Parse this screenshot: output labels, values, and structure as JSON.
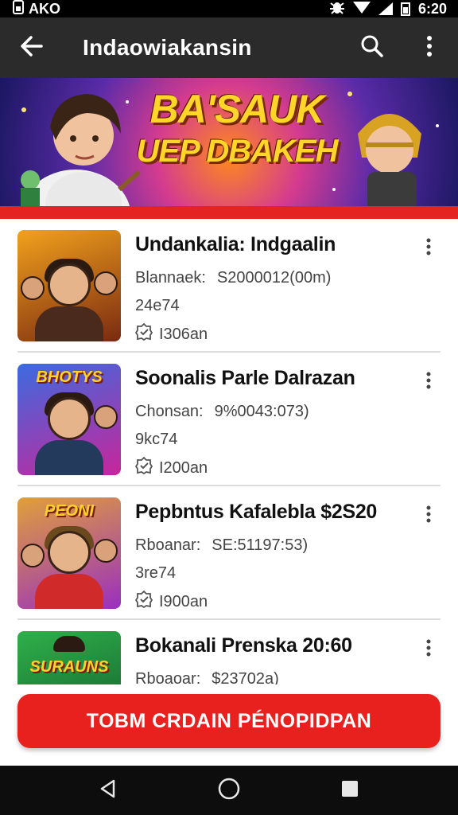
{
  "status_bar": {
    "left_text": "AKO",
    "time": "6:20",
    "icons": [
      "sim-icon",
      "bug-icon",
      "wifi-icon",
      "signal-icon",
      "battery-icon"
    ]
  },
  "app_bar": {
    "title": "Indaowiakansin",
    "icons": [
      "back-arrow-icon",
      "search-icon",
      "more-vert-icon"
    ]
  },
  "banner": {
    "line1": "BA'SAUK",
    "line2": "UEP DBAKEH"
  },
  "items": [
    {
      "title": "Undankalia: Indgaalin",
      "meta_label": "Blannaek:",
      "meta_value": "S2000012(00m)",
      "count": "24e74",
      "verified": "I306an",
      "thumb_title": "",
      "thumb_colors": [
        "#f2a21c",
        "#7a2a10"
      ]
    },
    {
      "title": "Soonalis Parle Dalrazan",
      "meta_label": "Chonsan:",
      "meta_value": "9%0043:073)",
      "count": "9kc74",
      "verified": "I200an",
      "thumb_title": "BHOTYS",
      "thumb_colors": [
        "#3b6be0",
        "#c9259a"
      ]
    },
    {
      "title": "Pepbntus Kafalebla $2S20",
      "meta_label": "Rboanar:",
      "meta_value": "SE:51197:53)",
      "count": "3re74",
      "verified": "I900an",
      "thumb_title": "PEONI",
      "thumb_colors": [
        "#e0a03a",
        "#9a2ec0"
      ]
    },
    {
      "title": "Bokanali Prenska 20:60",
      "meta_label": "Rboaoar:",
      "meta_value": "$23702a)",
      "count": "",
      "verified": "",
      "thumb_title": "SURAUNS",
      "thumb_colors": [
        "#2fb04a",
        "#115a2a"
      ]
    }
  ],
  "cta": {
    "label": "TOBM CRDAIN PÉNOPIDPAN",
    "color": "#e8201e"
  },
  "nav_bar": {
    "icons": [
      "back-triangle-icon",
      "home-circle-icon",
      "recents-square-icon"
    ]
  },
  "colors": {
    "accent": "#e52421",
    "app_bar": "#2b2b2b"
  }
}
